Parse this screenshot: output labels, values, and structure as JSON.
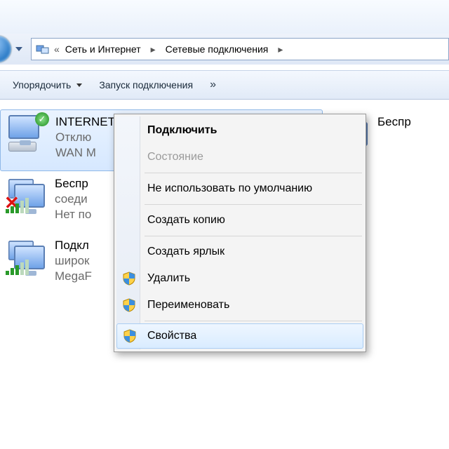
{
  "breadcrumb": {
    "back_chev": "«",
    "seg1": "Сеть и Интернет",
    "seg2": "Сетевые подключения",
    "sep": "▸"
  },
  "toolbar": {
    "organize": "Упорядочить",
    "start_conn": "Запуск подключения",
    "overflow": "»"
  },
  "connections": {
    "left": [
      {
        "title": "INTERNET",
        "line1": "Отклю",
        "line2": "WAN M",
        "selected": true,
        "kind": "dialup"
      },
      {
        "title": "Беспр",
        "line1": "соеди",
        "line2": "Нет по",
        "selected": false,
        "kind": "wifi-off"
      },
      {
        "title": "Подкл",
        "line1": "широк",
        "line2": "MegaF",
        "selected": false,
        "kind": "wifi"
      }
    ],
    "right": [
      {
        "title": "Беспр"
      }
    ]
  },
  "context_menu": {
    "connect": "Подключить",
    "status": "Состояние",
    "not_default": "Не использовать по умолчанию",
    "copy": "Создать копию",
    "shortcut": "Создать ярлык",
    "delete": "Удалить",
    "rename": "Переименовать",
    "properties": "Свойства"
  },
  "icons": {
    "ok_check": "✓"
  }
}
